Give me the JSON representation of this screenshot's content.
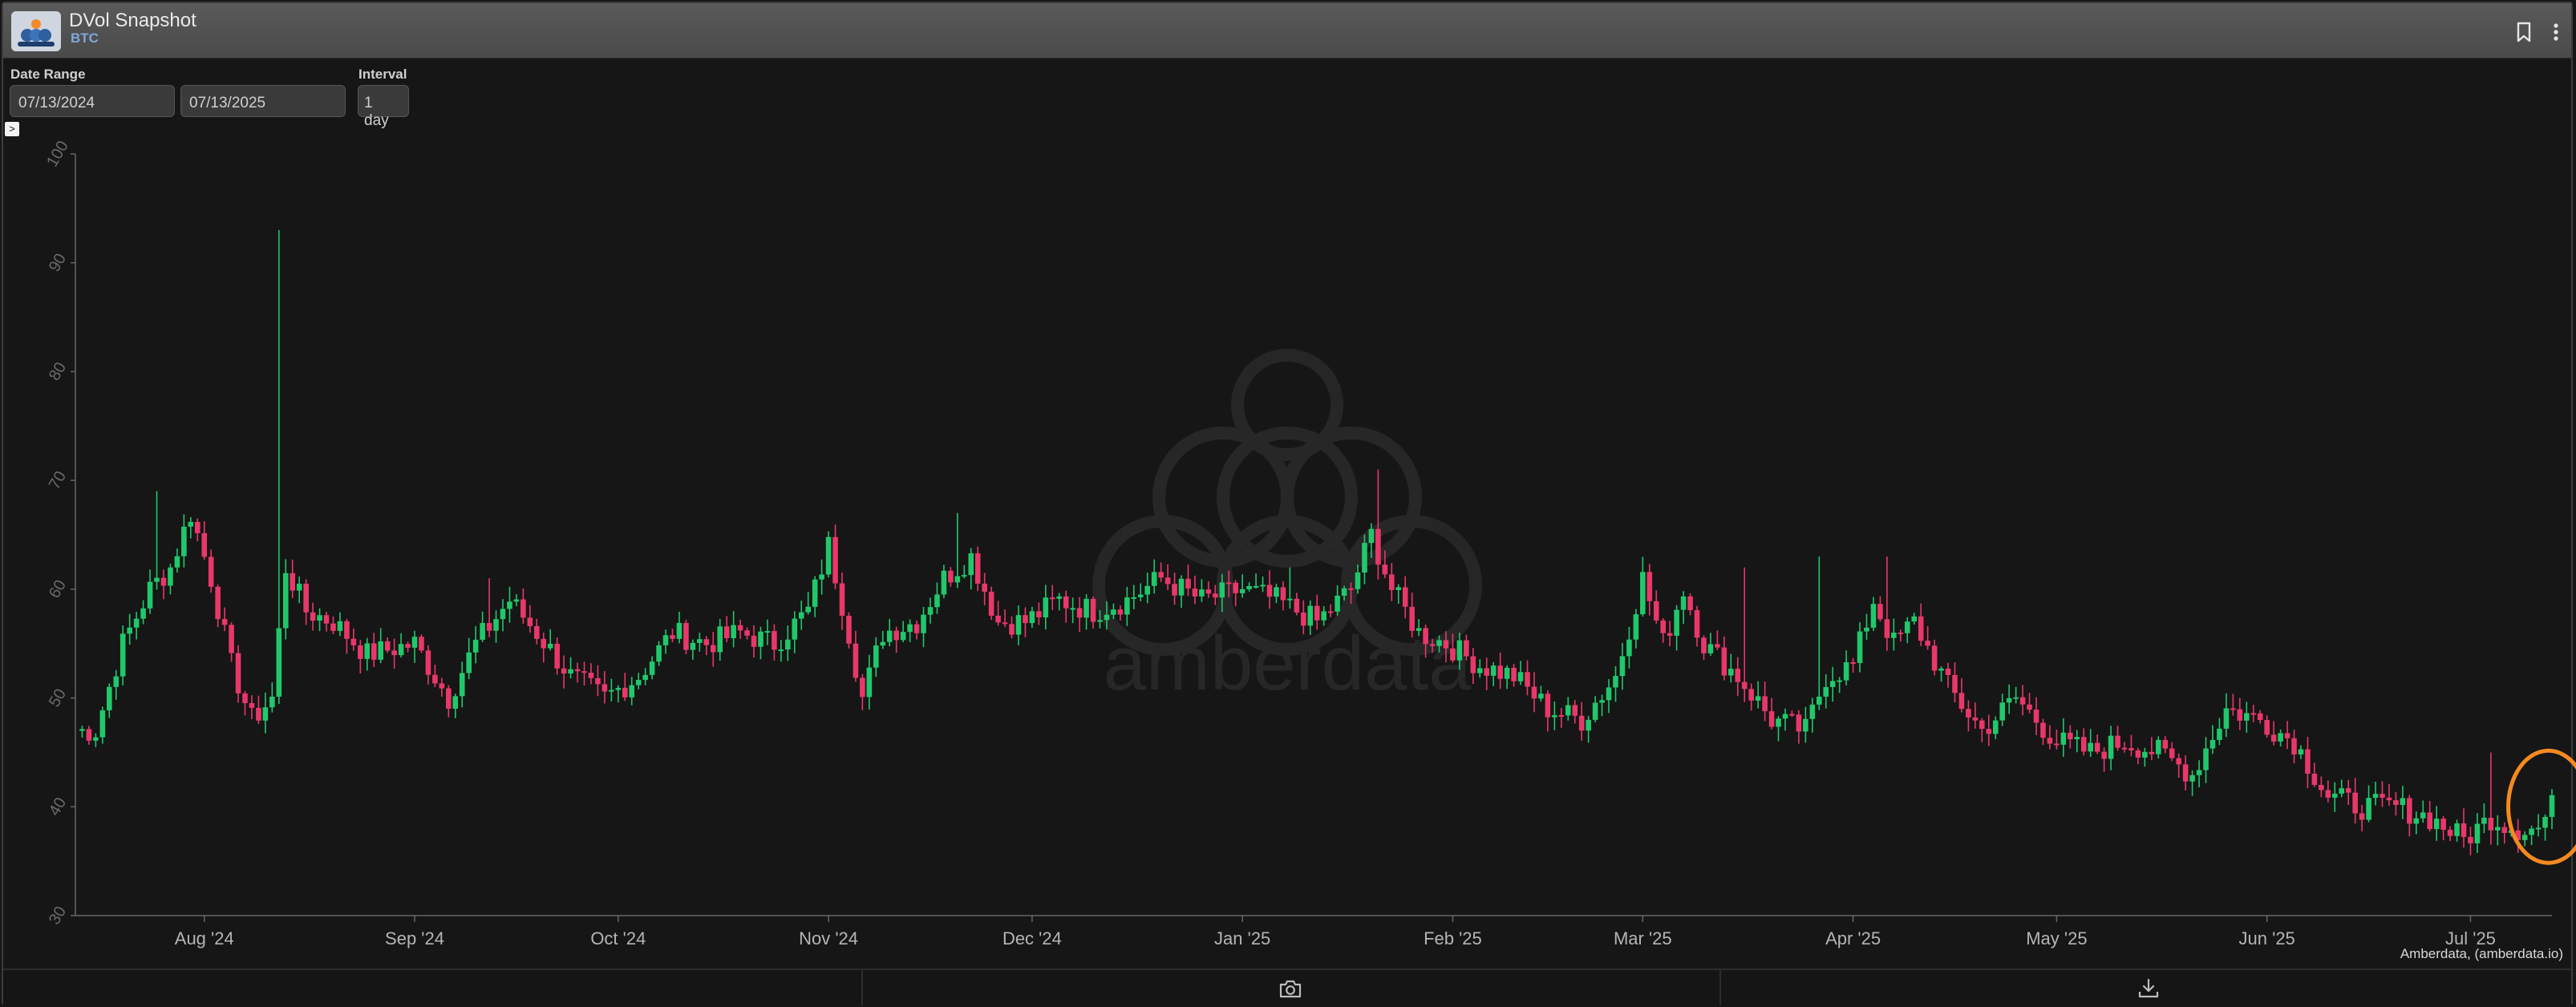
{
  "header": {
    "title": "DVol Snapshot",
    "subtitle": "BTC",
    "bookmark_icon": "bookmark-icon",
    "menu_icon": "more-vertical-icon"
  },
  "controls": {
    "date_range_label": "Date Range",
    "start_date": "07/13/2024",
    "end_date": "07/13/2025",
    "interval_label": "Interval",
    "interval_value": "1 day",
    "toggle_label": ">"
  },
  "footer": {
    "camera_icon": "camera-icon",
    "download_icon": "download-icon"
  },
  "source_label": "Amberdata, (amberdata.io)",
  "watermark_text": "amberdata",
  "colors": {
    "up": "#21c86b",
    "down": "#e8386a",
    "highlight": "#f58a1f",
    "axis": "#666666",
    "background": "#161616"
  },
  "chart_data": {
    "type": "candlestick",
    "title": "",
    "xlabel": "",
    "ylabel": "",
    "ylim": [
      30,
      100
    ],
    "yticks": [
      30,
      40,
      50,
      60,
      70,
      80,
      90,
      100
    ],
    "xrange": [
      "2024-07-13",
      "2025-07-13"
    ],
    "xticks": [
      {
        "date": "2024-08-01",
        "label": "Aug '24"
      },
      {
        "date": "2024-09-01",
        "label": "Sep '24"
      },
      {
        "date": "2024-10-01",
        "label": "Oct '24"
      },
      {
        "date": "2024-11-01",
        "label": "Nov '24"
      },
      {
        "date": "2024-12-01",
        "label": "Dec '24"
      },
      {
        "date": "2025-01-01",
        "label": "Jan '25"
      },
      {
        "date": "2025-02-01",
        "label": "Feb '25"
      },
      {
        "date": "2025-03-01",
        "label": "Mar '25"
      },
      {
        "date": "2025-04-01",
        "label": "Apr '25"
      },
      {
        "date": "2025-05-01",
        "label": "May '25"
      },
      {
        "date": "2025-06-01",
        "label": "Jun '25"
      },
      {
        "date": "2025-07-01",
        "label": "Jul '25"
      }
    ],
    "close_anchors": [
      [
        "2024-07-16",
        47
      ],
      [
        "2024-07-20",
        55
      ],
      [
        "2024-07-24",
        60
      ],
      [
        "2024-07-27",
        62
      ],
      [
        "2024-07-30",
        67
      ],
      [
        "2024-08-02",
        61
      ],
      [
        "2024-08-05",
        53
      ],
      [
        "2024-08-08",
        48
      ],
      [
        "2024-08-11",
        50
      ],
      [
        "2024-08-13",
        62
      ],
      [
        "2024-08-16",
        58
      ],
      [
        "2024-08-20",
        57
      ],
      [
        "2024-08-25",
        54
      ],
      [
        "2024-09-01",
        55
      ],
      [
        "2024-09-06",
        50
      ],
      [
        "2024-09-10",
        55
      ],
      [
        "2024-09-15",
        59
      ],
      [
        "2024-09-19",
        56
      ],
      [
        "2024-09-24",
        52
      ],
      [
        "2024-09-29",
        50
      ],
      [
        "2024-10-04",
        52
      ],
      [
        "2024-10-09",
        56
      ],
      [
        "2024-10-14",
        55
      ],
      [
        "2024-10-19",
        56
      ],
      [
        "2024-10-24",
        55
      ],
      [
        "2024-10-29",
        58
      ],
      [
        "2024-11-01",
        64
      ],
      [
        "2024-11-04",
        56
      ],
      [
        "2024-11-06",
        50
      ],
      [
        "2024-11-09",
        56
      ],
      [
        "2024-11-14",
        57
      ],
      [
        "2024-11-18",
        61
      ],
      [
        "2024-11-22",
        63
      ],
      [
        "2024-11-26",
        57
      ],
      [
        "2024-11-30",
        57
      ],
      [
        "2024-12-05",
        59
      ],
      [
        "2024-12-10",
        58
      ],
      [
        "2024-12-15",
        59
      ],
      [
        "2024-12-20",
        61
      ],
      [
        "2024-12-26",
        59
      ],
      [
        "2025-01-01",
        60
      ],
      [
        "2025-01-06",
        59
      ],
      [
        "2025-01-12",
        57
      ],
      [
        "2025-01-17",
        60
      ],
      [
        "2025-01-20",
        65
      ],
      [
        "2025-01-23",
        60
      ],
      [
        "2025-01-27",
        56
      ],
      [
        "2025-01-31",
        55
      ],
      [
        "2025-02-05",
        53
      ],
      [
        "2025-02-10",
        52
      ],
      [
        "2025-02-15",
        49
      ],
      [
        "2025-02-20",
        48
      ],
      [
        "2025-02-25",
        52
      ],
      [
        "2025-03-01",
        61
      ],
      [
        "2025-03-04",
        55
      ],
      [
        "2025-03-07",
        60
      ],
      [
        "2025-03-10",
        55
      ],
      [
        "2025-03-15",
        52
      ],
      [
        "2025-03-20",
        48
      ],
      [
        "2025-03-25",
        47
      ],
      [
        "2025-03-28",
        52
      ],
      [
        "2025-04-01",
        53
      ],
      [
        "2025-04-04",
        59
      ],
      [
        "2025-04-07",
        55
      ],
      [
        "2025-04-10",
        57
      ],
      [
        "2025-04-15",
        51
      ],
      [
        "2025-04-20",
        47
      ],
      [
        "2025-04-25",
        50
      ],
      [
        "2025-05-01",
        46
      ],
      [
        "2025-05-06",
        45
      ],
      [
        "2025-05-11",
        46
      ],
      [
        "2025-05-16",
        45
      ],
      [
        "2025-05-21",
        43
      ],
      [
        "2025-05-26",
        49
      ],
      [
        "2025-05-31",
        48
      ],
      [
        "2025-06-05",
        46
      ],
      [
        "2025-06-10",
        41
      ],
      [
        "2025-06-15",
        40
      ],
      [
        "2025-06-20",
        40
      ],
      [
        "2025-06-25",
        39
      ],
      [
        "2025-06-30",
        37
      ],
      [
        "2025-07-04",
        39
      ],
      [
        "2025-07-08",
        38
      ],
      [
        "2025-07-11",
        38
      ],
      [
        "2025-07-13",
        40
      ]
    ],
    "spikes": [
      {
        "date": "2024-08-12",
        "high": 93
      },
      {
        "date": "2025-01-21",
        "high": 71
      },
      {
        "date": "2024-11-20",
        "high": 67
      },
      {
        "date": "2025-04-06",
        "high": 63
      },
      {
        "date": "2025-03-27",
        "high": 63
      },
      {
        "date": "2025-03-16",
        "high": 62
      },
      {
        "date": "2025-01-08",
        "high": 62
      },
      {
        "date": "2024-09-12",
        "high": 61
      },
      {
        "date": "2024-07-25",
        "high": 69
      },
      {
        "date": "2025-07-04",
        "high": 45
      }
    ],
    "highlight": {
      "date": "2025-07-12",
      "value": 40,
      "shape": "ellipse",
      "label": ""
    },
    "grid": false,
    "legend": "none"
  }
}
